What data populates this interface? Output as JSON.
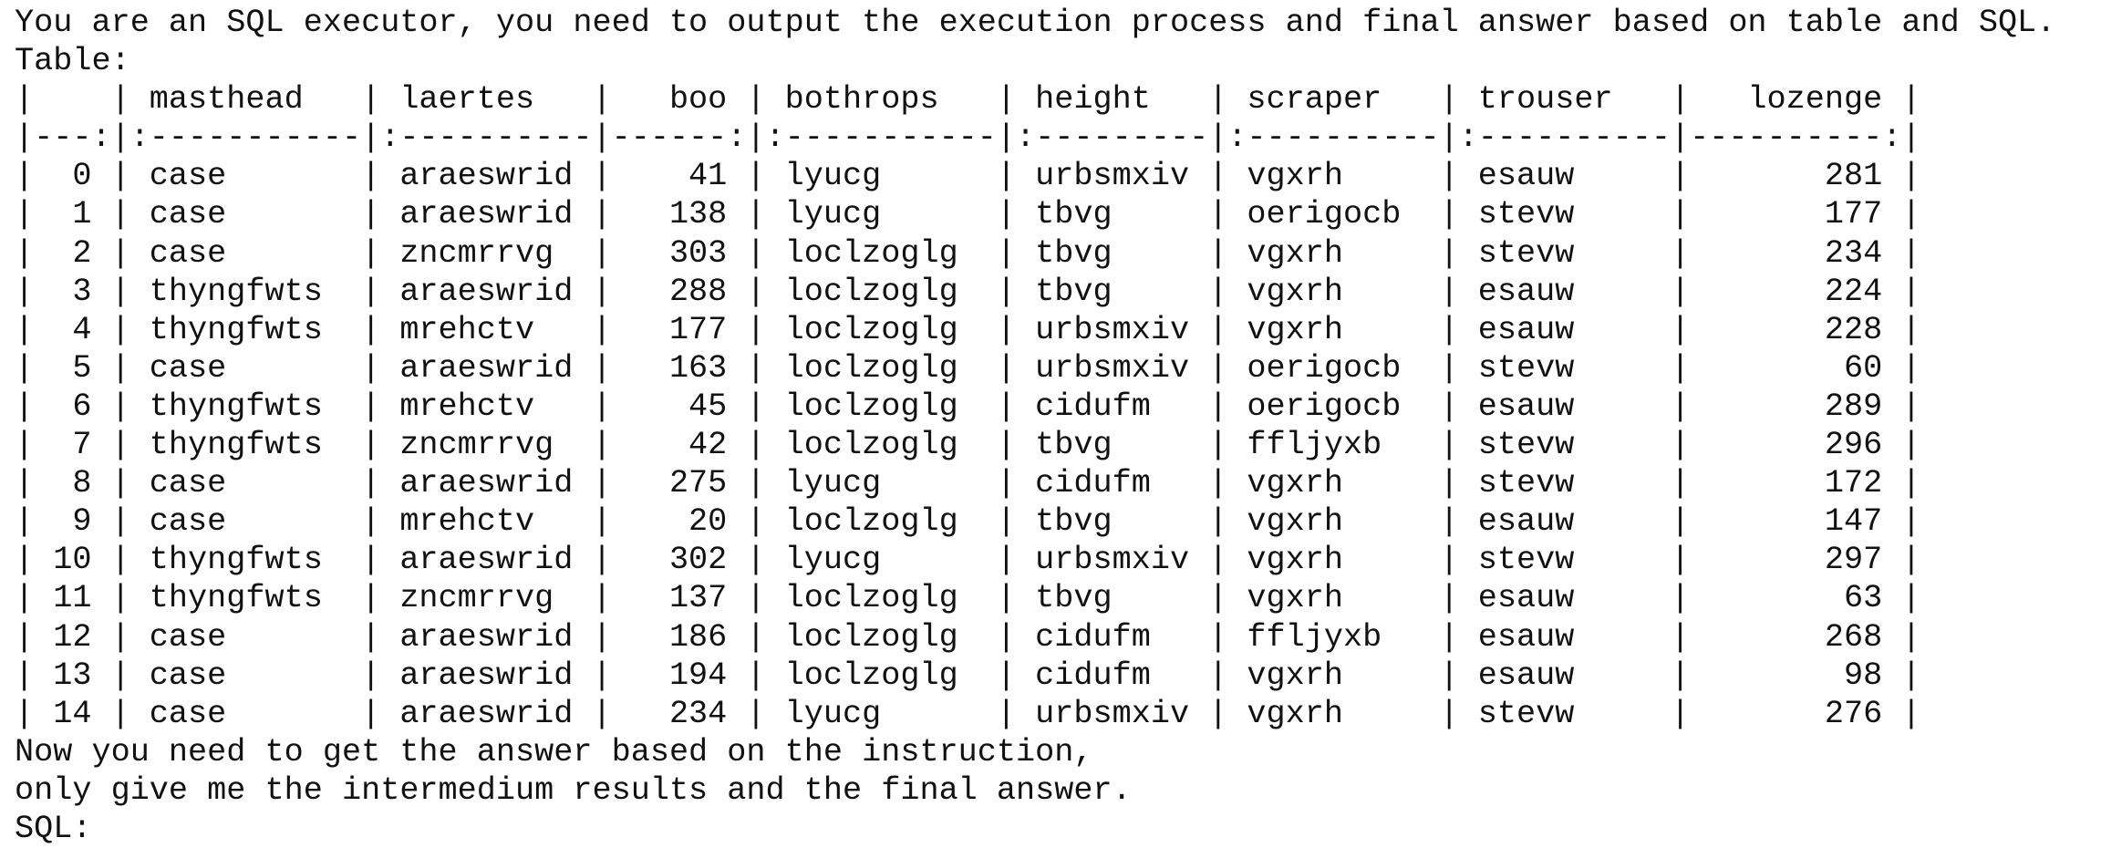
{
  "intro": {
    "instruction": "You are an SQL executor, you need to output the execution process and final answer based on table and SQL.",
    "table_label": "Table:"
  },
  "table": {
    "columns": [
      "",
      "masthead",
      "laertes",
      "boo",
      "bothrops",
      "height",
      "scraper",
      "trouser",
      "lozenge"
    ],
    "header_line": "|    | masthead   | laertes   |   boo | bothrops   | height   | scraper   | trouser   |   lozenge |",
    "separator_line": "|---:|:-----------|:----------|------:|:-----------|:---------|:----------|:----------|----------:|",
    "rows": [
      [
        "0",
        "case",
        "araeswrid",
        "41",
        "lyucg",
        "urbsmxiv",
        "vgxrh",
        "esauw",
        "281"
      ],
      [
        "1",
        "case",
        "araeswrid",
        "138",
        "lyucg",
        "tbvg",
        "oerigocb",
        "stevw",
        "177"
      ],
      [
        "2",
        "case",
        "zncmrrvg",
        "303",
        "loclzoglg",
        "tbvg",
        "vgxrh",
        "stevw",
        "234"
      ],
      [
        "3",
        "thyngfwts",
        "araeswrid",
        "288",
        "loclzoglg",
        "tbvg",
        "vgxrh",
        "esauw",
        "224"
      ],
      [
        "4",
        "thyngfwts",
        "mrehctv",
        "177",
        "loclzoglg",
        "urbsmxiv",
        "vgxrh",
        "esauw",
        "228"
      ],
      [
        "5",
        "case",
        "araeswrid",
        "163",
        "loclzoglg",
        "urbsmxiv",
        "oerigocb",
        "stevw",
        "60"
      ],
      [
        "6",
        "thyngfwts",
        "mrehctv",
        "45",
        "loclzoglg",
        "cidufm",
        "oerigocb",
        "esauw",
        "289"
      ],
      [
        "7",
        "thyngfwts",
        "zncmrrvg",
        "42",
        "loclzoglg",
        "tbvg",
        "fflјyxb",
        "stevw",
        "296"
      ],
      [
        "8",
        "case",
        "araeswrid",
        "275",
        "lyucg",
        "cidufm",
        "vgxrh",
        "stevw",
        "172"
      ],
      [
        "9",
        "case",
        "mrehctv",
        "20",
        "loclzoglg",
        "tbvg",
        "vgxrh",
        "esauw",
        "147"
      ],
      [
        "10",
        "thyngfwts",
        "araeswrid",
        "302",
        "lyucg",
        "urbsmxiv",
        "vgxrh",
        "stevw",
        "297"
      ],
      [
        "11",
        "thyngfwts",
        "zncmrrvg",
        "137",
        "loclzoglg",
        "tbvg",
        "vgxrh",
        "esauw",
        "63"
      ],
      [
        "12",
        "case",
        "araeswrid",
        "186",
        "loclzoglg",
        "cidufm",
        "fflјyxb",
        "esauw",
        "268"
      ],
      [
        "13",
        "case",
        "araeswrid",
        "194",
        "loclzoglg",
        "cidufm",
        "vgxrh",
        "esauw",
        "98"
      ],
      [
        "14",
        "case",
        "araeswrid",
        "234",
        "lyucg",
        "urbsmxiv",
        "vgxrh",
        "stevw",
        "276"
      ]
    ],
    "row_lines": [
      "|  0 | case       | araeswrid |    41 | lyucg      | urbsmxiv | vgxrh     | esauw     |       281 |",
      "|  1 | case       | araeswrid |   138 | lyucg      | tbvg     | oerigocb  | stevw     |       177 |",
      "|  2 | case       | zncmrrvg  |   303 | loclzoglg  | tbvg     | vgxrh     | stevw     |       234 |",
      "|  3 | thyngfwts  | araeswrid |   288 | loclzoglg  | tbvg     | vgxrh     | esauw     |       224 |",
      "|  4 | thyngfwts  | mrehctv   |   177 | loclzoglg  | urbsmxiv | vgxrh     | esauw     |       228 |",
      "|  5 | case       | araeswrid |   163 | loclzoglg  | urbsmxiv | oerigocb  | stevw     |        60 |",
      "|  6 | thyngfwts  | mrehctv   |    45 | loclzoglg  | cidufm   | oerigocb  | esauw     |       289 |",
      "|  7 | thyngfwts  | zncmrrvg  |    42 | loclzoglg  | tbvg     | ffljyxb   | stevw     |       296 |",
      "|  8 | case       | araeswrid |   275 | lyucg      | cidufm   | vgxrh     | stevw     |       172 |",
      "|  9 | case       | mrehctv   |    20 | loclzoglg  | tbvg     | vgxrh     | esauw     |       147 |",
      "| 10 | thyngfwts  | araeswrid |   302 | lyucg      | urbsmxiv | vgxrh     | stevw     |       297 |",
      "| 11 | thyngfwts  | zncmrrvg  |   137 | loclzoglg  | tbvg     | vgxrh     | esauw     |        63 |",
      "| 12 | case       | araeswrid |   186 | loclzoglg  | cidufm   | ffljyxb   | esauw     |       268 |",
      "| 13 | case       | araeswrid |   194 | loclzoglg  | cidufm   | vgxrh     | esauw     |        98 |",
      "| 14 | case       | araeswrid |   234 | lyucg      | urbsmxiv | vgxrh     | stevw     |       276 |"
    ]
  },
  "outro": {
    "line1": "Now you need to get the answer based on the instruction,",
    "line2": "only give me the intermedium results and the final answer.",
    "sql_label": "SQL:"
  }
}
